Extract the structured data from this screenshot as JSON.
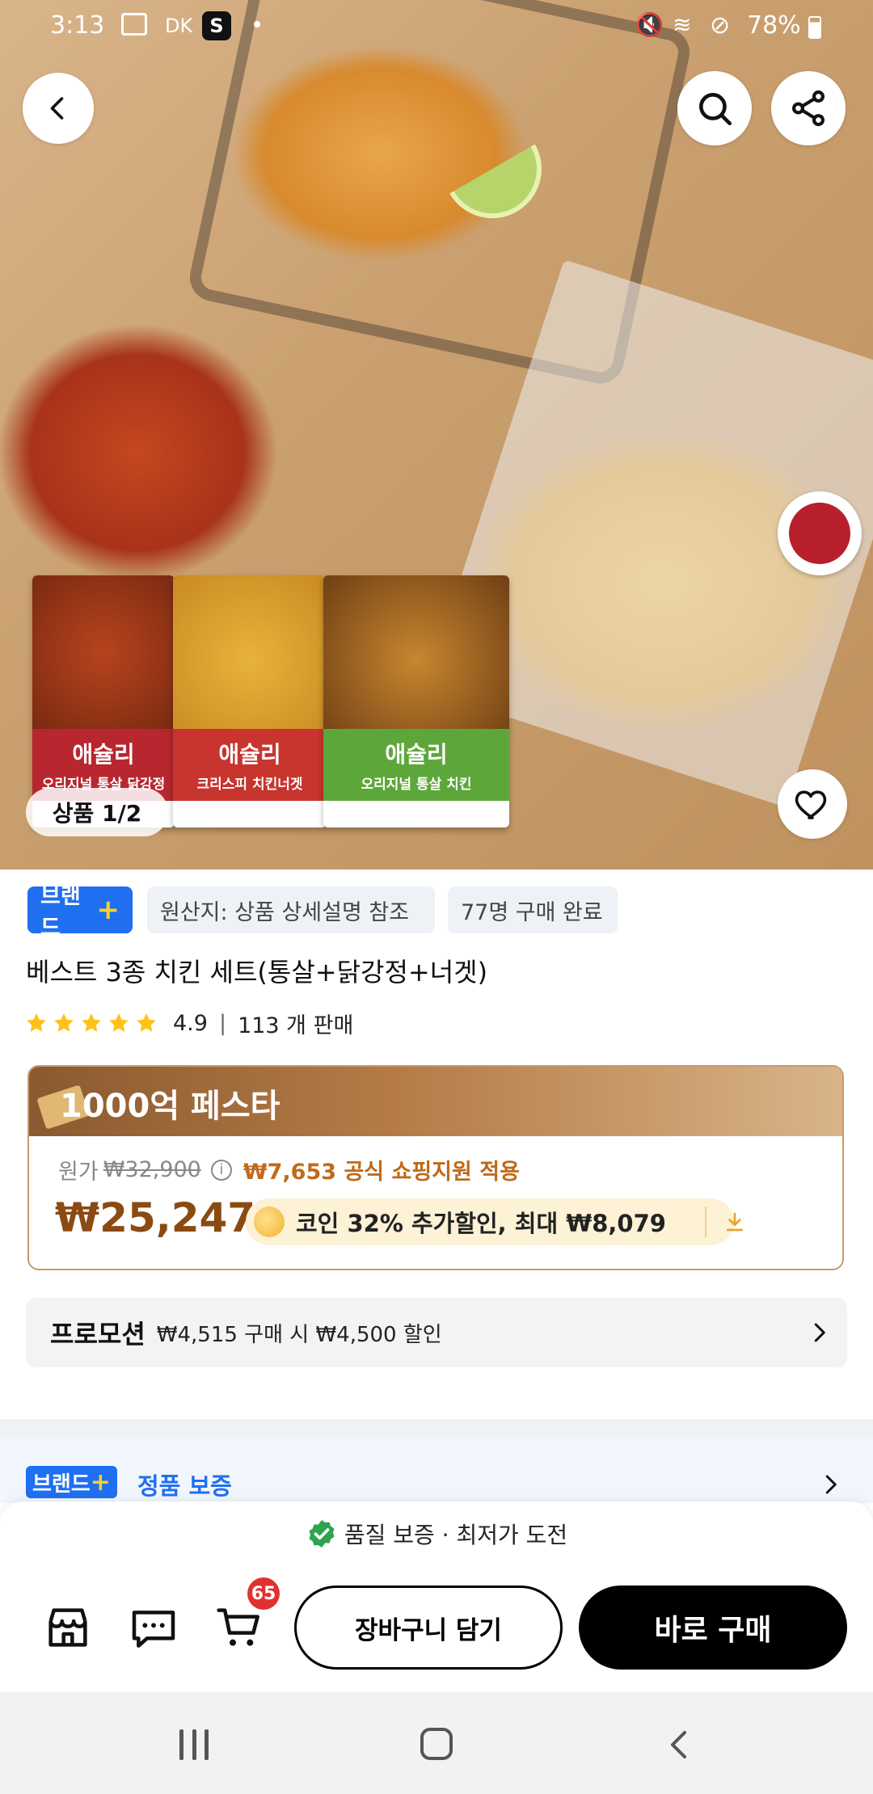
{
  "status_bar": {
    "time": "3:13",
    "battery": "78%",
    "carrier_text": "DK",
    "app_badge": "S"
  },
  "hero": {
    "counter": "상품 1/2"
  },
  "packs": [
    {
      "line1": "애슐리",
      "line2": "오리지널 통살 닭강정",
      "color": "#b8262f"
    },
    {
      "line1": "애슐리",
      "line2": "크리스피 치킨너겟",
      "color": "#c8342e"
    },
    {
      "line1": "애슐리",
      "line2": "오리지널 통살 치킨",
      "color": "#5da73a"
    }
  ],
  "chips": {
    "brand": "브랜드",
    "brand_plus": "+",
    "origin": "원산지: 상품 상세설명 참조",
    "buyers": "77명 구매 완료"
  },
  "product": {
    "title": "베스트 3종 치킨 세트(통살+닭강정+너겟)",
    "rating": "4.9",
    "divider": "|",
    "sold": "113 개 판매",
    "stars": 5
  },
  "festa": {
    "title": "1000억 페스타",
    "orig_label": "원가",
    "orig_price": "₩32,900",
    "support": "₩7,653 공식 쇼핑지원 적용",
    "final_price": "₩25,247",
    "coin_text": "코인 32% 추가할인, 최대 ₩8,079"
  },
  "promotion": {
    "label": "프로모션",
    "text": "₩4,515 구매 시 ₩4,500 할인"
  },
  "brand_row": {
    "badge": "브랜드",
    "badge_plus": "+",
    "text": "정품 보증"
  },
  "bottom": {
    "guarantee": "품질 보증 · 최저가 도전",
    "cart_count": "65",
    "cart_button": "장바구니 담기",
    "buy_button": "바로 구매"
  },
  "colors": {
    "accent_blue": "#1f6ff0",
    "brand_plus_yellow": "#ffd21e",
    "price_brown": "#8a4a12",
    "support_orange": "#c06a1a",
    "check_green": "#2ea44f",
    "badge_red": "#e03131"
  }
}
